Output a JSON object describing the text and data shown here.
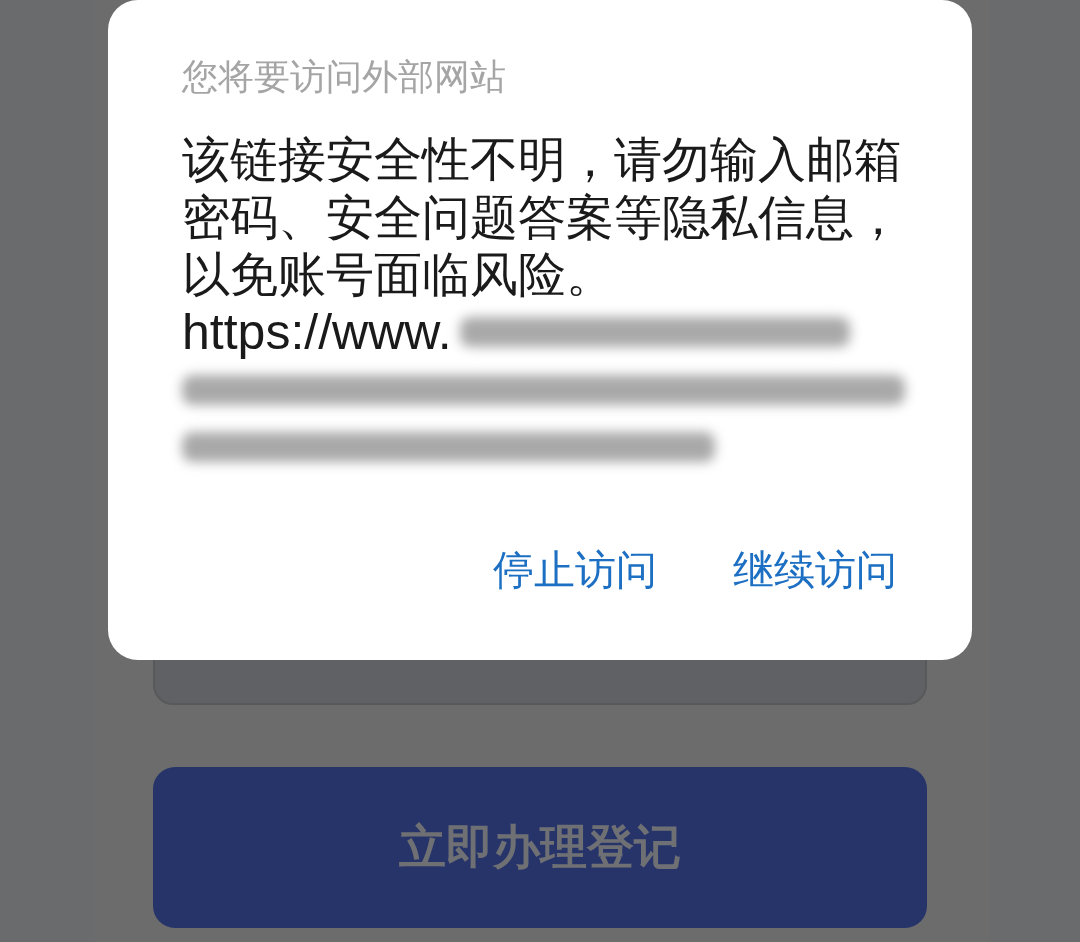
{
  "background_page": {
    "submit_button": {
      "label": "立即办理登记"
    }
  },
  "dialog": {
    "title": "您将要访问外部网站",
    "message": "该链接安全性不明，请勿输入邮箱密码、安全问题答案等隐私信息，以免账号面临风险。",
    "url": "https://www.",
    "url_redacted": true,
    "actions": [
      {
        "label": "停止访问"
      },
      {
        "label": "继续访问"
      }
    ]
  }
}
